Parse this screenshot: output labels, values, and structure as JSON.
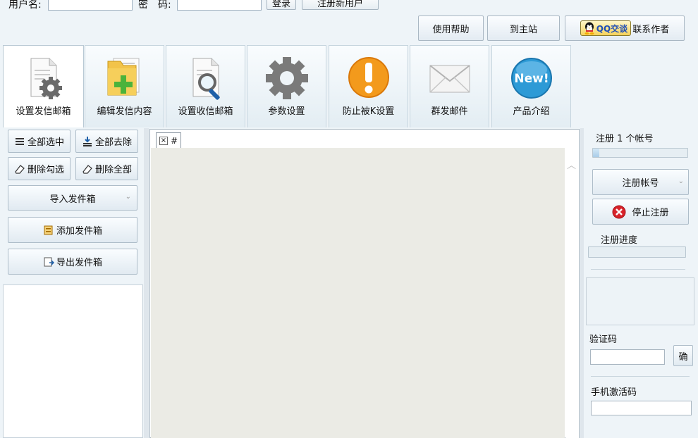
{
  "login": {
    "username_label": "用户名:",
    "password_label": "密　码:",
    "username_value": "",
    "password_value": "",
    "login_button": "登录",
    "register_button": "注册新用户"
  },
  "top_actions": {
    "help": "使用帮助",
    "home": "到主站",
    "qq_badge": "QQ交谈",
    "contact": "联系作者"
  },
  "toolbar": [
    {
      "label": "设置发信邮箱",
      "icon": "document-gear-icon"
    },
    {
      "label": "编辑发信内容",
      "icon": "folder-add-icon"
    },
    {
      "label": "设置收信邮箱",
      "icon": "document-search-icon"
    },
    {
      "label": "参数设置",
      "icon": "gear-icon"
    },
    {
      "label": "防止被K设置",
      "icon": "warning-icon"
    },
    {
      "label": "群发邮件",
      "icon": "envelope-icon"
    },
    {
      "label": "产品介绍",
      "icon": "new-badge-icon",
      "badge_text": "New!"
    }
  ],
  "left_panel": {
    "select_all": "全部选中",
    "deselect_all": "全部去除",
    "delete_checked": "删除勾选",
    "delete_all": "删除全部",
    "import_outbox": "导入发件箱",
    "add_outbox": "添加发件箱",
    "export_outbox": "导出发件箱"
  },
  "center": {
    "tab_label": "#"
  },
  "right_panel": {
    "register_count": "注册 1 个帐号",
    "register_progress": 0.07,
    "register_account": "注册帐号",
    "stop_register": "停止注册",
    "progress_label": "注册进度",
    "progress_value": 0,
    "captcha_label": "验证码",
    "captcha_value": "",
    "confirm_button": "确",
    "phone_code_label": "手机激活码",
    "phone_code_value": ""
  },
  "colors": {
    "background": "#eef4f8",
    "warning_orange": "#f39a1c",
    "stop_red": "#d8232a",
    "new_blue": "#2d9ad6"
  }
}
